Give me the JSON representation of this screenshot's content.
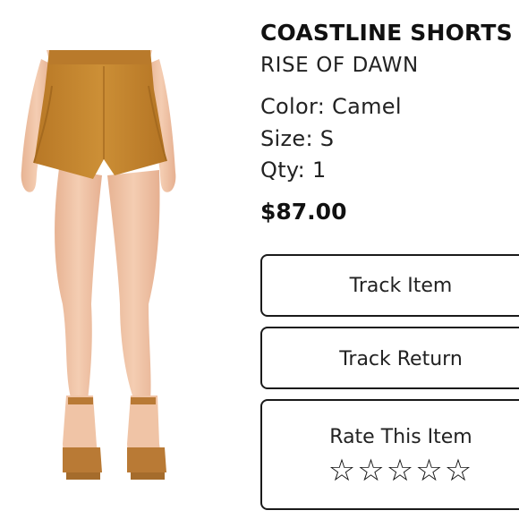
{
  "product": {
    "title": "COASTLINE SHORTS",
    "brand": "RISE OF DAWN",
    "color_text": "Color: Camel",
    "size_text": "Size: S",
    "qty_text": "Qty: 1",
    "price": "$87.00"
  },
  "actions": {
    "track_item": "Track Item",
    "track_return": "Track Return",
    "rate_item": "Rate This Item"
  },
  "rating": {
    "value": 0,
    "max": 5,
    "star_glyph": "☆"
  },
  "colors": {
    "shorts": "#c5862e",
    "skin": "#f0c4a6",
    "shoes": "#b97a35",
    "text": "#111111",
    "button_border": "#1a1a1a"
  }
}
